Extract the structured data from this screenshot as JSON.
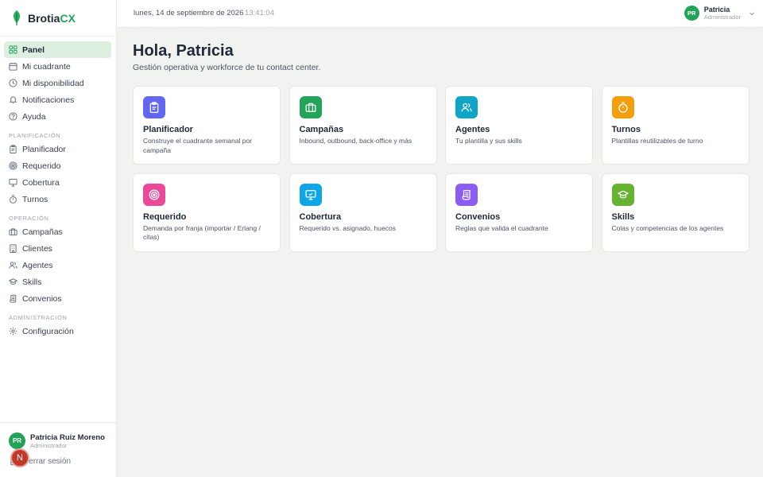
{
  "brand": {
    "name_main": "Brotia",
    "name_accent": "CX"
  },
  "sidebar": {
    "items_top": [
      {
        "label": "Panel",
        "icon": "grid-icon",
        "active": true
      },
      {
        "label": "Mi cuadrante",
        "icon": "calendar-icon"
      },
      {
        "label": "Mi disponibilidad",
        "icon": "clock-icon"
      },
      {
        "label": "Notificaciones",
        "icon": "bell-icon"
      },
      {
        "label": "Ayuda",
        "icon": "help-icon"
      }
    ],
    "section_planificacion": "PLANIFICACIÓN",
    "items_planificacion": [
      {
        "label": "Planificador",
        "icon": "clipboard-icon"
      },
      {
        "label": "Requerido",
        "icon": "target-icon"
      },
      {
        "label": "Cobertura",
        "icon": "monitor-icon"
      },
      {
        "label": "Turnos",
        "icon": "timer-icon"
      }
    ],
    "section_operacion": "OPERACIÓN",
    "items_operacion": [
      {
        "label": "Campañas",
        "icon": "briefcase-icon"
      },
      {
        "label": "Clientes",
        "icon": "building-icon"
      },
      {
        "label": "Agentes",
        "icon": "users-icon"
      },
      {
        "label": "Skills",
        "icon": "graduation-cap-icon"
      },
      {
        "label": "Convenios",
        "icon": "scroll-icon"
      }
    ],
    "section_administracion": "ADMINISTRACIÓN",
    "items_administracion": [
      {
        "label": "Configuración",
        "icon": "gear-icon"
      }
    ],
    "footer": {
      "initials": "PR",
      "name": "Patricia Ruiz Moreno",
      "role": "Administrador",
      "logout": "Cerrar sesión",
      "fab_letter": "N"
    }
  },
  "topbar": {
    "date": "lunes, 14 de septiembre de 2026",
    "separator": "·",
    "time": "13:41:04",
    "user": {
      "initials": "PR",
      "name": "Patricia",
      "role": "Administrador"
    }
  },
  "main": {
    "title": "Hola, Patricia",
    "subtitle": "Gestión operativa y workforce de tu contact center.",
    "cards": [
      {
        "title": "Planificador",
        "desc": "Construye el cuadrante semanal por campaña",
        "icon": "clipboard-icon",
        "color": "#6366f1"
      },
      {
        "title": "Campañas",
        "desc": "Inbound, outbound, back-office y más",
        "icon": "briefcase-icon",
        "color": "#22a35a"
      },
      {
        "title": "Agentes",
        "desc": "Tu plantilla y sus skills",
        "icon": "users-icon",
        "color": "#0ea5c6"
      },
      {
        "title": "Turnos",
        "desc": "Plantillas reutilizables de turno",
        "icon": "timer-icon",
        "color": "#f59e0b"
      },
      {
        "title": "Requerido",
        "desc": "Demanda por franja (importar / Erlang / citas)",
        "icon": "target-icon",
        "color": "#ec4899"
      },
      {
        "title": "Cobertura",
        "desc": "Requerido vs. asignado, huecos",
        "icon": "monitor-icon",
        "color": "#0ea5e9"
      },
      {
        "title": "Convenios",
        "desc": "Reglas que valida el cuadrante",
        "icon": "scroll-icon",
        "color": "#8b5cf6"
      },
      {
        "title": "Skills",
        "desc": "Colas y competencias de los agentes",
        "icon": "graduation-cap-icon",
        "color": "#65b32e"
      }
    ]
  }
}
